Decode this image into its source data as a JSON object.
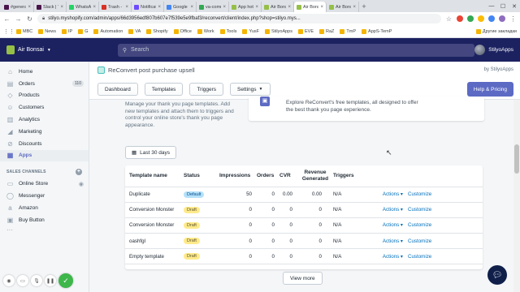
{
  "browser": {
    "tabs": [
      {
        "label": "#general",
        "color": "#4a154b",
        "active": false
      },
      {
        "label": "Slack | T",
        "color": "#4a154b",
        "active": false
      },
      {
        "label": "WhatsApp",
        "color": "#25d366",
        "active": false
      },
      {
        "label": "Trash - v",
        "color": "#d93025",
        "active": false
      },
      {
        "label": "Notificati",
        "color": "#6d4aff",
        "active": false
      },
      {
        "label": "Google",
        "color": "#4285f4",
        "active": false
      },
      {
        "label": "va-comm",
        "color": "#34a853",
        "active": false
      },
      {
        "label": "App hot",
        "color": "#95bf47",
        "active": false
      },
      {
        "label": "Air Bons",
        "color": "#95bf47",
        "active": false
      },
      {
        "label": "Air Bons",
        "color": "#95bf47",
        "active": true
      },
      {
        "label": "Air Bons",
        "color": "#95bf47",
        "active": false
      }
    ],
    "new_tab": "+",
    "url": "stilyo.myshopify.com/admin/apps/66d3956edf807b607e7f539e5e9fbaf3/reconvert/client/index.php?shop=stilyo.mys...",
    "bookmarks": [
      "MBC",
      "News",
      "IP",
      "G",
      "Automation",
      "VA",
      "Shopify",
      "Office",
      "Work",
      "Tools",
      "YusF",
      "StilyoApps",
      "EVE",
      "RaZ",
      "TmP",
      "AppS-TemP"
    ],
    "bookmarks_other": "Другие закладки"
  },
  "topbar": {
    "store_name": "Air Bonsai",
    "search_placeholder": "Search",
    "user_name": "StilyoApps"
  },
  "sidebar": {
    "items": [
      {
        "label": "Home",
        "icon": "home-icon",
        "glyph": "⌂"
      },
      {
        "label": "Orders",
        "icon": "orders-icon",
        "glyph": "▤",
        "badge": "110"
      },
      {
        "label": "Products",
        "icon": "products-icon",
        "glyph": "◇"
      },
      {
        "label": "Customers",
        "icon": "customers-icon",
        "glyph": "☺"
      },
      {
        "label": "Analytics",
        "icon": "analytics-icon",
        "glyph": "▥"
      },
      {
        "label": "Marketing",
        "icon": "marketing-icon",
        "glyph": "◢"
      },
      {
        "label": "Discounts",
        "icon": "discounts-icon",
        "glyph": "⊘"
      },
      {
        "label": "Apps",
        "icon": "apps-icon",
        "glyph": "▦",
        "active": true
      }
    ],
    "sales_channels_heading": "SALES CHANNELS",
    "channels": [
      {
        "label": "Online Store",
        "glyph": "▭"
      },
      {
        "label": "Messenger",
        "glyph": "◯"
      },
      {
        "label": "Amazon",
        "glyph": "a"
      },
      {
        "label": "Buy Button",
        "glyph": "▣"
      }
    ],
    "more": "···"
  },
  "app": {
    "title": "ReConvert post purchase upsell",
    "byline": "by StilyoApps",
    "buttons": {
      "dashboard": "Dashboard",
      "templates": "Templates",
      "triggers": "Triggers",
      "settings": "Settings"
    },
    "help_button": "Help & Pricing"
  },
  "main": {
    "description": "Manage your thank you page templates. Add new templates and attach them to triggers and control your online store's thank you page appearance.",
    "explore_text": "Explore ReConvert's free templates, all designed to offer the best thank you page experience.",
    "date_range": "Last 30 days",
    "view_more": "View more"
  },
  "table": {
    "headers": [
      "Template name",
      "Status",
      "Impressions",
      "Orders",
      "CVR",
      "Revenue Generated",
      "Triggers"
    ],
    "rows": [
      {
        "name": "Duplicate",
        "status": "Default",
        "status_type": "default",
        "impressions": "50",
        "orders": "0",
        "cvr": "0.00",
        "revenue": "0.00",
        "triggers": "N/A",
        "actions": "Actions",
        "customize": "Customize"
      },
      {
        "name": "Conversion Monster",
        "status": "Draft",
        "status_type": "draft",
        "impressions": "0",
        "orders": "0",
        "cvr": "0",
        "revenue": "0",
        "triggers": "N/A",
        "actions": "Actions",
        "customize": "Customize"
      },
      {
        "name": "Conversion Monster",
        "status": "Draft",
        "status_type": "draft",
        "impressions": "0",
        "orders": "0",
        "cvr": "0",
        "revenue": "0",
        "triggers": "N/A",
        "actions": "Actions",
        "customize": "Customize"
      },
      {
        "name": "oashfgl",
        "status": "Draft",
        "status_type": "draft",
        "impressions": "0",
        "orders": "0",
        "cvr": "0",
        "revenue": "0",
        "triggers": "N/A",
        "actions": "Actions",
        "customize": "Customize"
      },
      {
        "name": "Empty template",
        "status": "Draft",
        "status_type": "draft",
        "impressions": "0",
        "orders": "0",
        "cvr": "0",
        "revenue": "0",
        "triggers": "N/A",
        "actions": "Actions",
        "customize": "Customize"
      }
    ]
  },
  "colors": {
    "topbar": "#1c2260",
    "accent": "#5c6ac4",
    "link": "#006fbb",
    "draft_badge": "#ffea8a",
    "default_badge": "#b4e1fa"
  }
}
